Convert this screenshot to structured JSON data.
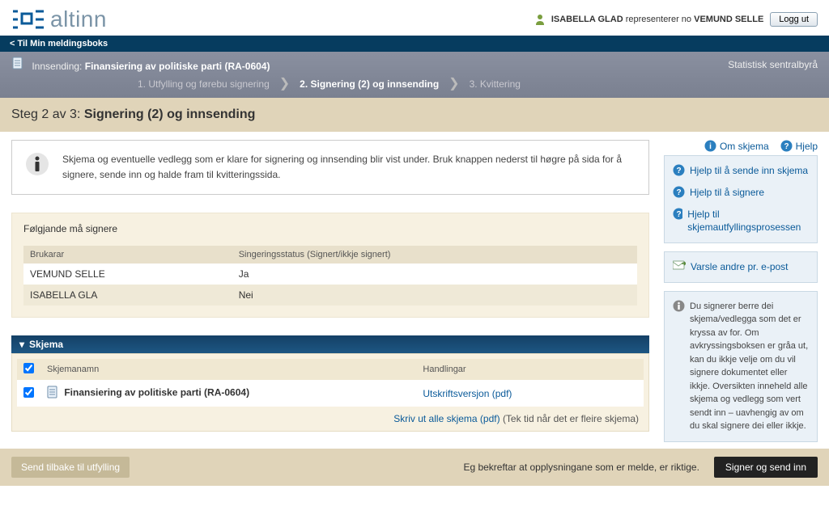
{
  "header": {
    "logo_text": "altinn",
    "user_name": "ISABELLA GLAD",
    "rep_text": "representerer no",
    "rep_name": "VEMUND SELLE",
    "logout": "Logg ut"
  },
  "topbar": {
    "back_link": "< Til Min meldingsboks"
  },
  "breadcrumb": {
    "prefix": "Innsending: ",
    "title": "Finansiering av politiske parti (RA-0604)",
    "agency": "Statistisk sentralbyrå",
    "steps": [
      "1. Utfylling og førebu signering",
      "2. Signering (2) og innsending",
      "3. Kvittering"
    ]
  },
  "step_bar": {
    "pre": "Steg 2 av 3: ",
    "title": "Signering (2) og innsending"
  },
  "meta": {
    "about": "Om skjema",
    "help": "Hjelp"
  },
  "info": {
    "text": "Skjema og eventuelle vedlegg som er klare for signering og innsending blir vist under. Bruk knappen nederst til høgre på sida for å signere, sende inn og halde fram til kvitteringssida."
  },
  "signers": {
    "heading": "Følgjande må signere",
    "col_user": "Brukarar",
    "col_status": "Singeringsstatus (Signert/ikkje signert)",
    "rows": [
      {
        "user": "VEMUND SELLE",
        "status": "Ja"
      },
      {
        "user": "ISABELLA GLA",
        "status": "Nei"
      }
    ]
  },
  "schema": {
    "collapse_label": "Skjema",
    "col_name": "Skjemanamn",
    "col_actions": "Handlingar",
    "row_name": "Finansiering av politiske parti (RA-0604)",
    "row_action": "Utskriftsversjon (pdf)",
    "print_all": "Skriv ut alle skjema (pdf)",
    "print_hint": "(Tek tid når det er fleire skjema)"
  },
  "help_links": {
    "send": "Hjelp til å sende inn skjema",
    "sign": "Hjelp til å signere",
    "fill": "Hjelp til skjemautfyllingsprosessen",
    "notify": "Varsle andre pr. e-post",
    "info_text": "Du signerer berre dei skjema/vedlegga som det er kryssa av for. Om avkryssingsboksen er gråa ut, kan du ikkje velje om du vil signere dokumentet eller ikkje. Oversikten inneheld alle skjema og vedlegg som vert sendt inn – uavhengig av om du skal signere dei eller ikkje."
  },
  "actions": {
    "back": "Send tilbake til utfylling",
    "confirm": "Eg bekreftar at opplysningane som er melde, er riktige.",
    "submit": "Signer og send inn"
  }
}
